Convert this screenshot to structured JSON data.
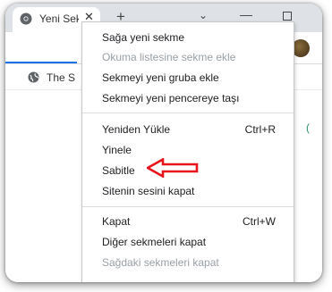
{
  "tab": {
    "title": "Yeni Sekme",
    "close": "✕"
  },
  "window": {
    "new_tab": "+",
    "tab_search": "⌄",
    "minimize": "—"
  },
  "bookmarks": {
    "item_label": "The Site"
  },
  "content": {
    "edge_text": "("
  },
  "menu": {
    "groups": [
      [
        {
          "label": "Sağa yeni sekme",
          "shortcut": "",
          "disabled": false
        },
        {
          "label": "Okuma listesine sekme ekle",
          "shortcut": "",
          "disabled": true
        },
        {
          "label": "Sekmeyi yeni gruba ekle",
          "shortcut": "",
          "disabled": false
        },
        {
          "label": "Sekmeyi yeni pencereye taşı",
          "shortcut": "",
          "disabled": false
        }
      ],
      [
        {
          "label": "Yeniden Yükle",
          "shortcut": "Ctrl+R",
          "disabled": false
        },
        {
          "label": "Yinele",
          "shortcut": "",
          "disabled": false
        },
        {
          "label": "Sabitle",
          "shortcut": "",
          "disabled": false
        },
        {
          "label": "Sitenin sesini kapat",
          "shortcut": "",
          "disabled": false
        }
      ],
      [
        {
          "label": "Kapat",
          "shortcut": "Ctrl+W",
          "disabled": false
        },
        {
          "label": "Diğer sekmeleri kapat",
          "shortcut": "",
          "disabled": false
        },
        {
          "label": "Sağdaki sekmeleri kapat",
          "shortcut": "",
          "disabled": true
        }
      ]
    ]
  },
  "annotation": {
    "arrow_color": "#e8141b",
    "points_to": "Sabitle"
  },
  "colors": {
    "tabstrip": "#dee1e6",
    "accent": "#1a73e8",
    "disabled_text": "#9aa0a6"
  }
}
